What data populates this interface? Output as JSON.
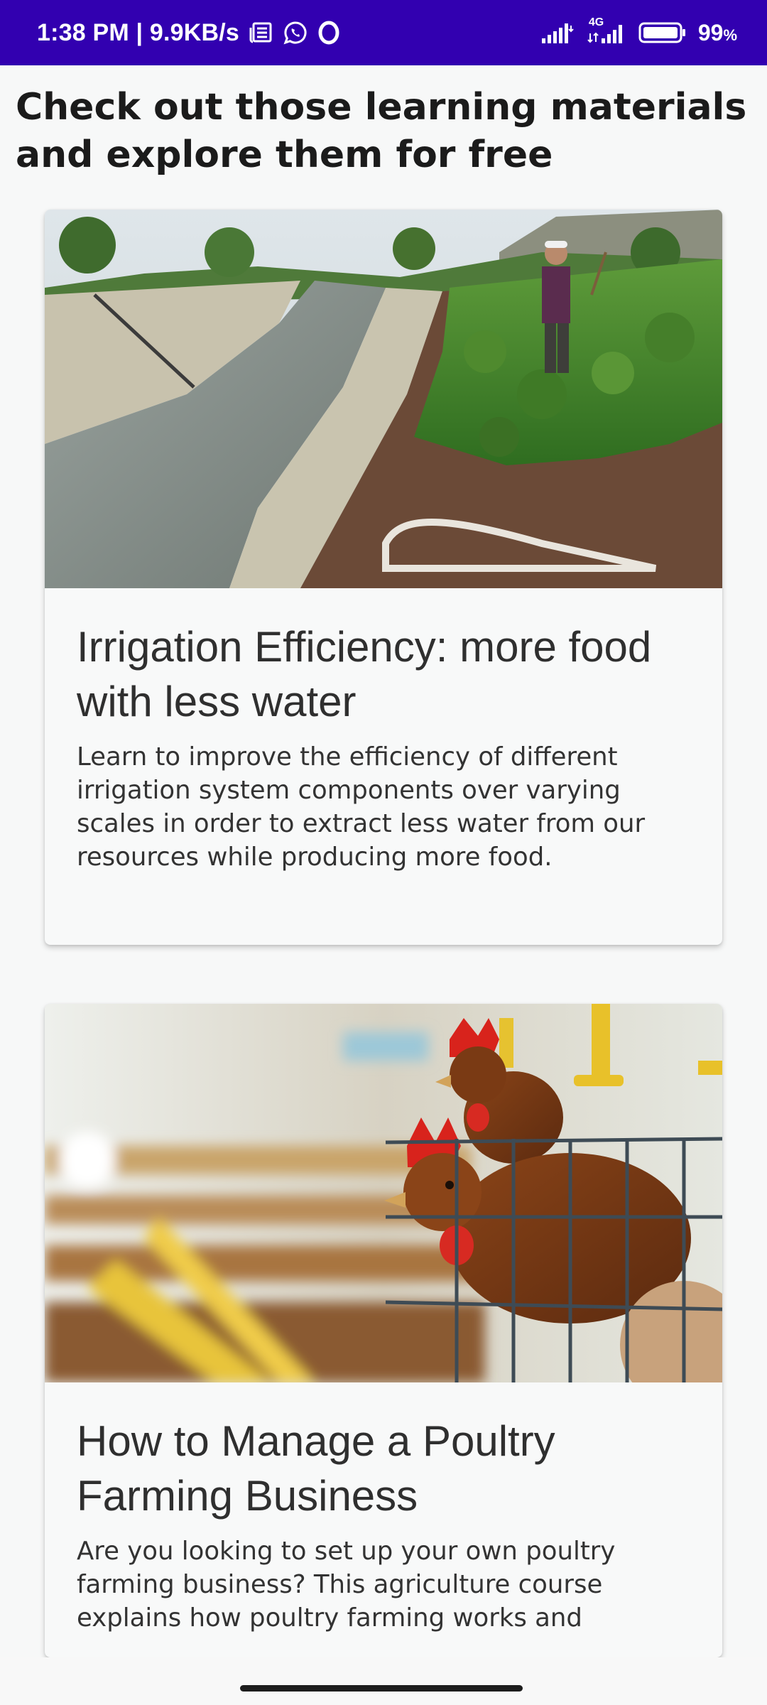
{
  "status_bar": {
    "time_speed": "1:38 PM | 9.9KB/s",
    "network_label": "4G",
    "battery": "99",
    "battery_unit": "%",
    "icons": [
      "news-icon",
      "whatsapp-icon",
      "opera-icon",
      "wifi-signal-icon",
      "cellular-signal-icon",
      "battery-icon"
    ]
  },
  "page": {
    "title": "Check out those learning materials and explore them for free"
  },
  "courses": [
    {
      "title": "Irrigation Efficiency: more food with less water",
      "description": "Learn to improve the efficiency of different irrigation system components over varying scales in order to extract less water from our resources while producing more food."
    },
    {
      "title": "How to Manage a Poultry Farming Business",
      "description": "Are you looking to set up your own poultry farming business? This agriculture course explains how poultry farming works and"
    }
  ],
  "colors": {
    "status_bar": "#3200b0",
    "background": "#f7f8f8",
    "card": "#f8f9f9",
    "title_text": "#1b1b1b"
  }
}
